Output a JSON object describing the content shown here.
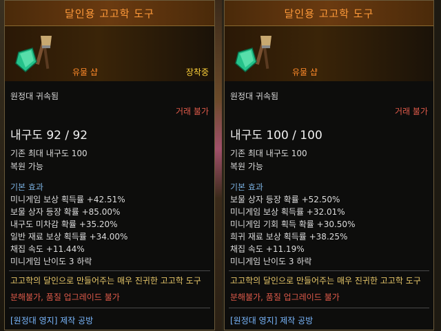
{
  "tooltips": [
    {
      "title": "달인용 고고학 도구",
      "grade": "유물 샵",
      "equipped": "장착중",
      "bound": "원정대 귀속됨",
      "trade": "거래 불가",
      "durability": "내구도 92 / 92",
      "max_durability": "기존 최대 내구도 100",
      "restorable": "복원 가능",
      "basic_effect_title": "기본 효과",
      "effects": [
        "미니게임 보상 획득률 +42.51%",
        "보물 상자 등장 확률 +85.00%",
        "내구도 미차감 확률 +35.20%",
        "일반 재료 보상 획득률 +34.00%",
        "채집 속도 +11.44%",
        "미니게임 난이도 3 하락"
      ],
      "description": "고고학의 달인으로 만들어주는 매우 진귀한 고고학 도구",
      "restriction": "분해불가, 품질 업그레이드 불가",
      "crafting": "[원정대 영지] 제작 공방"
    },
    {
      "title": "달인용 고고학 도구",
      "grade": "유물 샵",
      "equipped": "",
      "bound": "원정대 귀속됨",
      "trade": "거래 불가",
      "durability": "내구도 100 / 100",
      "max_durability": "기존 최대 내구도 100",
      "restorable": "복원 가능",
      "basic_effect_title": "기본 효과",
      "effects": [
        "보물 상자 등장 확률 +52.50%",
        "미니게임 보상 획득률 +32.01%",
        "미니게임 기회 획득 확률 +30.50%",
        "희귀 재료 보상 획득률 +38.25%",
        "채집 속도 +11.19%",
        "미니게임 난이도 3 하락"
      ],
      "description": "고고학의 달인으로 만들어주는 매우 진귀한 고고학 도구",
      "restriction": "분해불가, 품질 업그레이드 불가",
      "crafting": "[원정대 영지] 제작 공방"
    }
  ],
  "icons": [
    "shovel-brush-icon"
  ],
  "colors": {
    "title": "#ff9a3a",
    "grade": "#ff8a2a",
    "equipped": "#ffd23a",
    "section": "#7ab0e0",
    "warning": "#e05a4a",
    "description": "#e8c86a",
    "crafting": "#7ab8ff"
  }
}
